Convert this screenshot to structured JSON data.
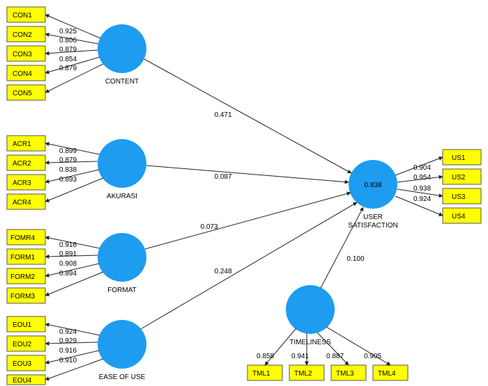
{
  "chart_data": {
    "type": "path-diagram",
    "title": "",
    "latent_variables": [
      {
        "name": "CONTENT",
        "rsq": null
      },
      {
        "name": "AKURASI",
        "rsq": null
      },
      {
        "name": "FORMAT",
        "rsq": null
      },
      {
        "name": "EASE OF USE",
        "rsq": null
      },
      {
        "name": "TIMELINESS",
        "rsq": null
      },
      {
        "name": "USER SATISFACTION",
        "rsq": 0.838
      }
    ],
    "outer_loadings": {
      "CONTENT": [
        {
          "indicator": "CON1",
          "loading": 0.925
        },
        {
          "indicator": "CON2",
          "loading": 0.806
        },
        {
          "indicator": "CON3",
          "loading": 0.879
        },
        {
          "indicator": "CON4",
          "loading": 0.854
        },
        {
          "indicator": "CON5",
          "loading": 0.879
        }
      ],
      "AKURASI": [
        {
          "indicator": "ACR1",
          "loading": 0.899
        },
        {
          "indicator": "ACR2",
          "loading": 0.879
        },
        {
          "indicator": "ACR3",
          "loading": 0.838
        },
        {
          "indicator": "ACR4",
          "loading": 0.893
        }
      ],
      "FORMAT": [
        {
          "indicator": "FOMR4",
          "loading": 0.916
        },
        {
          "indicator": "FORM1",
          "loading": 0.891
        },
        {
          "indicator": "FORM2",
          "loading": 0.908
        },
        {
          "indicator": "FORM3",
          "loading": 0.894
        }
      ],
      "EASE OF USE": [
        {
          "indicator": "EOU1",
          "loading": 0.924
        },
        {
          "indicator": "EOU2",
          "loading": 0.929
        },
        {
          "indicator": "EOU3",
          "loading": 0.916
        },
        {
          "indicator": "EOU4",
          "loading": 0.91
        }
      ],
      "TIMELINESS": [
        {
          "indicator": "TML1",
          "loading": 0.858
        },
        {
          "indicator": "TML2",
          "loading": 0.941
        },
        {
          "indicator": "TML3",
          "loading": 0.887
        },
        {
          "indicator": "TML4",
          "loading": 0.905
        }
      ],
      "USER SATISFACTION": [
        {
          "indicator": "US1",
          "loading": 0.904
        },
        {
          "indicator": "US2",
          "loading": 0.954
        },
        {
          "indicator": "US3",
          "loading": 0.938
        },
        {
          "indicator": "US4",
          "loading": 0.924
        }
      ]
    },
    "path_coefficients": [
      {
        "from": "CONTENT",
        "to": "USER SATISFACTION",
        "value": 0.471
      },
      {
        "from": "AKURASI",
        "to": "USER SATISFACTION",
        "value": 0.087
      },
      {
        "from": "FORMAT",
        "to": "USER SATISFACTION",
        "value": 0.073
      },
      {
        "from": "EASE OF USE",
        "to": "USER SATISFACTION",
        "value": 0.248
      },
      {
        "from": "TIMELINESS",
        "to": "USER SATISFACTION",
        "value": 0.1
      }
    ]
  },
  "indicators": {
    "con": [
      "CON1",
      "CON2",
      "CON3",
      "CON4",
      "CON5"
    ],
    "acr": [
      "ACR1",
      "ACR2",
      "ACR3",
      "ACR4"
    ],
    "form": [
      "FOMR4",
      "FORM1",
      "FORM2",
      "FORM3"
    ],
    "eou": [
      "EOU1",
      "EOU2",
      "EOU3",
      "EOU4"
    ],
    "us": [
      "US1",
      "US2",
      "US3",
      "US4"
    ],
    "tml": [
      "TML1",
      "TML2",
      "TML3",
      "TML4"
    ]
  },
  "labels": {
    "content": "CONTENT",
    "akurasi": "AKURASI",
    "format": "FORMAT",
    "ease": "EASE OF USE",
    "time": "TIMELINESS",
    "usat1": "USER",
    "usat2": "SATISFACTION",
    "usrsq": "0.838"
  },
  "load": {
    "con": [
      "0.925",
      "0.806",
      "0.879",
      "0.854",
      "0.879"
    ],
    "acr": [
      "0.899",
      "0.879",
      "0.838",
      "0.893"
    ],
    "form": [
      "0.916",
      "0.891",
      "0.908",
      "0.894"
    ],
    "eou": [
      "0.924",
      "0.929",
      "0.916",
      "0.910"
    ],
    "us": [
      "0.904",
      "0.954",
      "0.938",
      "0.924"
    ],
    "tml": [
      "0.858",
      "0.941",
      "0.887",
      "0.905"
    ]
  },
  "paths": {
    "content": "0.471",
    "akurasi": "0.087",
    "format": "0.073",
    "ease": "0.248",
    "time": "0.100"
  }
}
